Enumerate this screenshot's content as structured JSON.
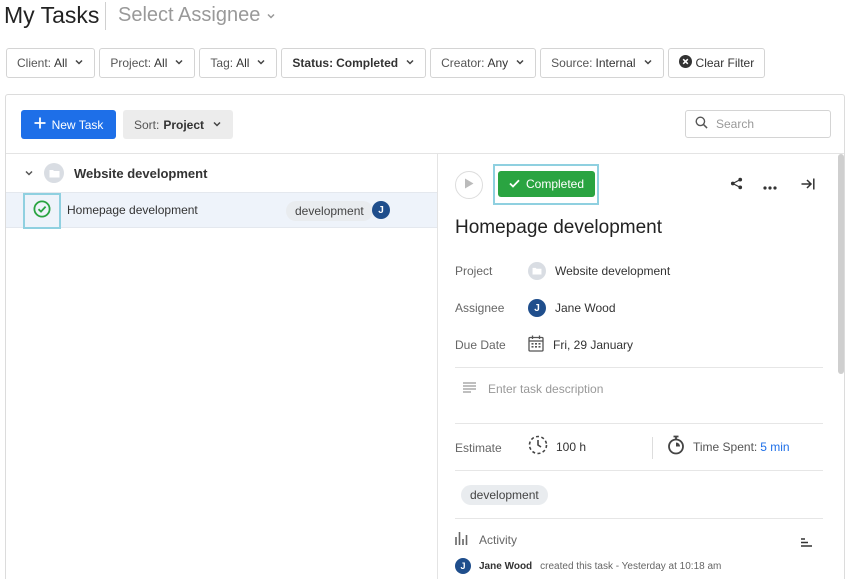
{
  "header": {
    "title": "My Tasks",
    "assignee_placeholder": "Select Assignee"
  },
  "filters": [
    {
      "label": "Client:",
      "value": "All",
      "bold": false
    },
    {
      "label": "Project:",
      "value": "All",
      "bold": false
    },
    {
      "label": "Tag:",
      "value": "All",
      "bold": false
    },
    {
      "label": "Status:",
      "value": "Completed",
      "bold": true
    },
    {
      "label": "Creator:",
      "value": "Any",
      "bold": false
    },
    {
      "label": "Source:",
      "value": "Internal",
      "bold": false
    }
  ],
  "clear_filter_label": "Clear Filter",
  "toolbar": {
    "new_task_label": "New Task",
    "sort_prefix": "Sort:",
    "sort_value": "Project",
    "search_placeholder": "Search"
  },
  "list": {
    "group_name": "Website development",
    "task": {
      "name": "Homepage development",
      "tag": "development",
      "assignee_initial": "J"
    }
  },
  "detail": {
    "status_label": "Completed",
    "title": "Homepage development",
    "project_label": "Project",
    "project_value": "Website development",
    "assignee_label": "Assignee",
    "assignee_value": "Jane Wood",
    "assignee_initial": "J",
    "due_label": "Due Date",
    "due_value": "Fri, 29 January",
    "description_placeholder": "Enter task description",
    "estimate_label": "Estimate",
    "estimate_value": "100 h",
    "time_spent_label": "Time Spent:",
    "time_spent_value": "5 min",
    "tag": "development",
    "activity_label": "Activity",
    "log_user": "Jane Wood",
    "log_text": "created this task - Yesterday at 10:18 am"
  },
  "colors": {
    "primary": "#1e6fe8",
    "success": "#2aa441",
    "avatar": "#1f4e8c",
    "highlight": "#8fd0e0"
  }
}
